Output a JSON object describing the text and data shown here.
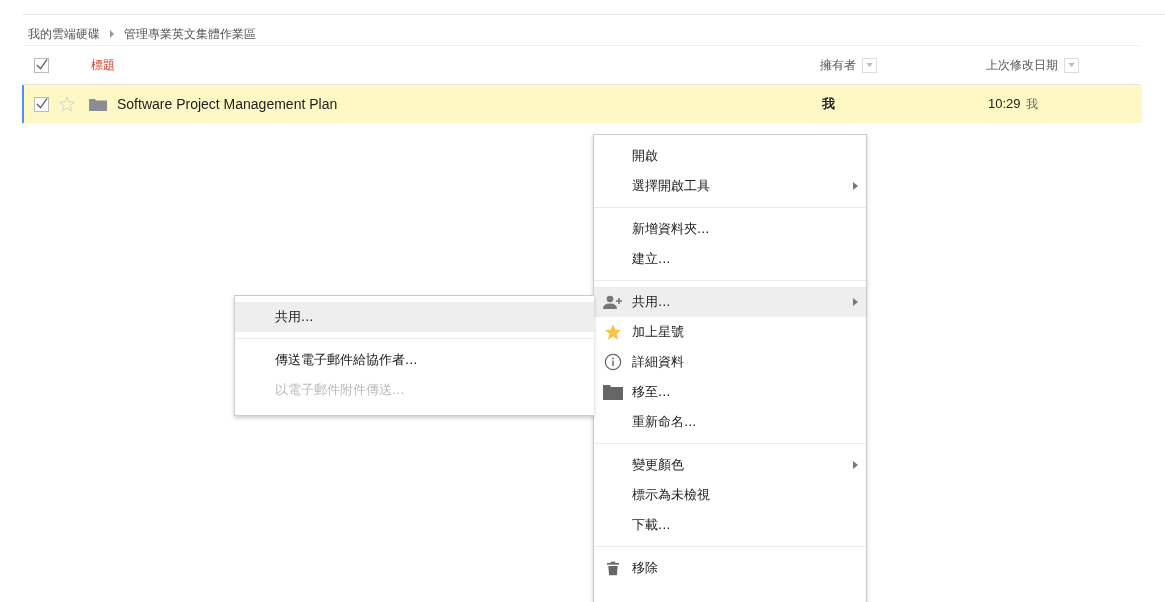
{
  "breadcrumb": [
    {
      "label": "我的雲端硬碟"
    },
    {
      "label": "管理專業英文集體作業區"
    }
  ],
  "table": {
    "header": {
      "checked": true,
      "columns": [
        {
          "label": "標題",
          "kind": "title"
        },
        {
          "label": "擁有者",
          "kind": "sortable"
        },
        {
          "label": "上次修改日期",
          "kind": "sortable"
        }
      ]
    },
    "rows": [
      {
        "checked": true,
        "starred": false,
        "selected": true,
        "title": "Software Project Management Plan",
        "owner": "我",
        "modified": "10:29",
        "modified_by": "我"
      }
    ]
  },
  "context_menu": {
    "groups": [
      [
        {
          "label": "開啟",
          "kind": "plain",
          "submenu": false,
          "selected": false
        },
        {
          "label": "選擇開啟工具",
          "kind": "plain",
          "submenu": true,
          "selected": false
        }
      ],
      [
        {
          "label": "新增資料夾...",
          "kind": "plain",
          "submenu": false,
          "selected": false
        },
        {
          "label": "建立...",
          "kind": "plain",
          "submenu": false,
          "selected": false
        }
      ],
      [
        {
          "label": "共用...",
          "kind": "share",
          "submenu": true,
          "selected": true
        },
        {
          "label": "加上星號",
          "kind": "star",
          "submenu": false,
          "selected": false
        },
        {
          "label": "詳細資料",
          "kind": "info",
          "submenu": false,
          "selected": false
        },
        {
          "label": "移至...",
          "kind": "folder",
          "submenu": false,
          "selected": false
        },
        {
          "label": "重新命名...",
          "kind": "plain",
          "submenu": false,
          "selected": false
        }
      ],
      [
        {
          "label": "變更顏色",
          "kind": "plain",
          "submenu": true,
          "selected": false
        },
        {
          "label": "標示為未檢視",
          "kind": "plain",
          "submenu": false,
          "selected": false
        },
        {
          "label": "下載...",
          "kind": "plain",
          "submenu": false,
          "selected": false
        }
      ],
      [
        {
          "label": "移除",
          "kind": "trash",
          "submenu": false,
          "selected": false
        }
      ]
    ]
  },
  "submenu": {
    "groups": [
      [
        {
          "label": "共用...",
          "selected": true,
          "disabled": false
        }
      ],
      [
        {
          "label": "傳送電子郵件給協作者...",
          "selected": false,
          "disabled": false
        },
        {
          "label": "以電子郵件附件傳送...",
          "selected": false,
          "disabled": true
        }
      ]
    ]
  }
}
